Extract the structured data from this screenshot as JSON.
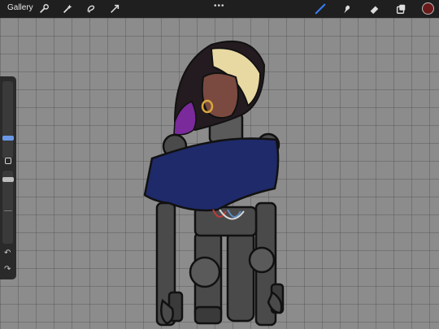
{
  "topbar": {
    "gallery_label": "Gallery",
    "tools_left": [
      "wrench-icon",
      "magic-wand-icon",
      "selection-icon",
      "transform-arrow-icon"
    ],
    "tools_right": [
      "brush-icon",
      "smudge-icon",
      "eraser-icon",
      "layers-icon"
    ],
    "more_label": "•••",
    "active_tool": "brush",
    "accent": "#3b7cf0",
    "current_color": "#6b1a1a"
  },
  "sidebar": {
    "undo_label": "↶",
    "redo_label": "↷"
  }
}
